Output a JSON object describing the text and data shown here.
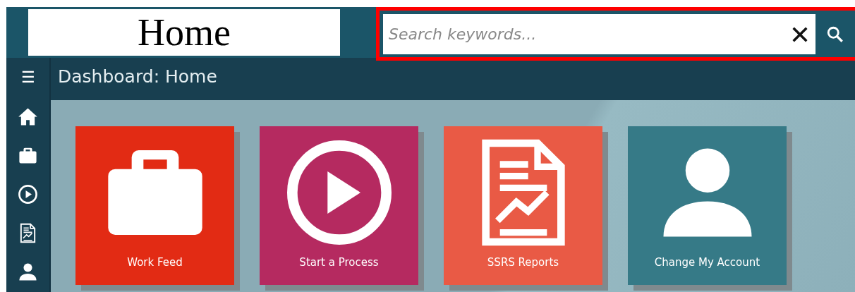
{
  "header": {
    "title": "Home",
    "search": {
      "placeholder": "Search keywords..."
    }
  },
  "nav": {
    "menu_icon": "☰",
    "title": "Dashboard: Home"
  },
  "sidebar": {
    "items": [
      {
        "kind": "home"
      },
      {
        "kind": "briefcase"
      },
      {
        "kind": "play"
      },
      {
        "kind": "report"
      },
      {
        "kind": "person"
      }
    ]
  },
  "tiles": [
    {
      "label": "Work Feed",
      "kind": "briefcase",
      "color": "#e22b14"
    },
    {
      "label": "Start a Process",
      "kind": "play",
      "color": "#b52a60"
    },
    {
      "label": "SSRS Reports",
      "kind": "report",
      "color": "#e95a45"
    },
    {
      "label": "Change My Account",
      "kind": "person",
      "color": "#367a87"
    }
  ]
}
